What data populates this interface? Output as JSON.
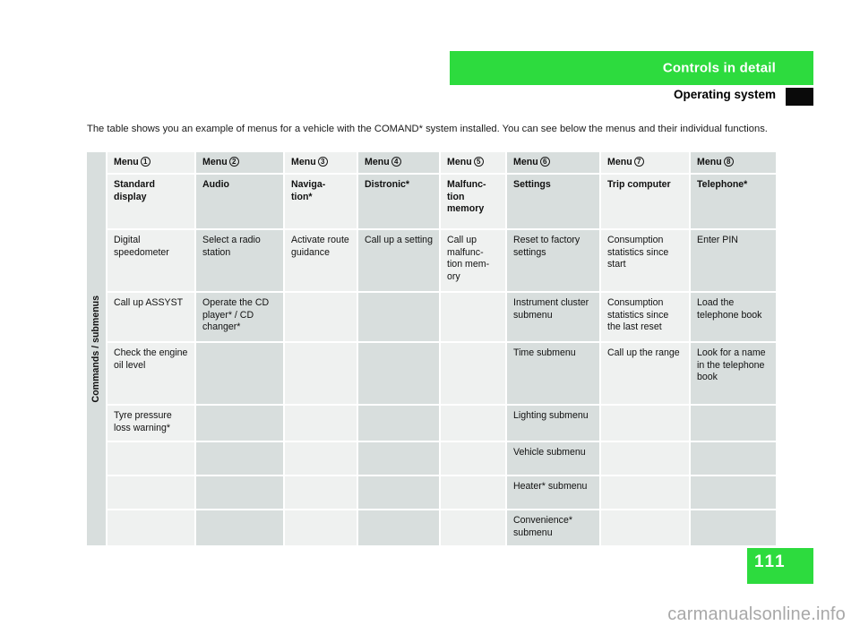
{
  "header": {
    "band_title": "Controls in detail",
    "subtitle": "Operating system",
    "band_color": "#2ddb3e",
    "square_color": "#0a0a0a"
  },
  "intro": "The table shows you an example of menus for a vehicle with the COMAND* system installed. You can see below the menus and their individual functions.",
  "table": {
    "side_label": "Commands / submenus",
    "column_headers": [
      {
        "label": "Menu",
        "number": "1"
      },
      {
        "label": "Menu",
        "number": "2"
      },
      {
        "label": "Menu",
        "number": "3"
      },
      {
        "label": "Menu",
        "number": "4"
      },
      {
        "label": "Menu",
        "number": "5"
      },
      {
        "label": "Menu",
        "number": "6"
      },
      {
        "label": "Menu",
        "number": "7"
      },
      {
        "label": "Menu",
        "number": "8"
      }
    ],
    "subheaders": [
      "Standard display",
      "Audio",
      "Naviga-\ntion*",
      "Distronic*",
      "Malfunc-\ntion\nmemory",
      "Settings",
      "Trip computer",
      "Telephone*"
    ],
    "rows": [
      [
        "Digital speedometer",
        "Select a radio station",
        "Activate route guidance",
        "Call up a setting",
        "Call up malfunc-\ntion mem-\nory",
        "Reset to factory settings",
        "Consumption statistics since start",
        "Enter PIN"
      ],
      [
        "Call up ASSYST",
        "Operate the CD player* / CD changer*",
        "",
        "",
        "",
        "Instrument cluster submenu",
        "Consumption statistics since the last reset",
        "Load the telephone book"
      ],
      [
        "Check the engine oil level",
        "",
        "",
        "",
        "",
        "Time submenu",
        "Call up the range",
        "Look for a name in the telephone book"
      ],
      [
        "Tyre pressure loss warning*",
        "",
        "",
        "",
        "",
        "Lighting submenu",
        "",
        ""
      ],
      [
        "",
        "",
        "",
        "",
        "",
        "Vehicle submenu",
        "",
        ""
      ],
      [
        "",
        "",
        "",
        "",
        "",
        "Heater* submenu",
        "",
        ""
      ],
      [
        "",
        "",
        "",
        "",
        "",
        "Convenience* submenu",
        "",
        ""
      ]
    ]
  },
  "footer": {
    "page_number": "111",
    "watermark": "carmanualsonline.info"
  }
}
